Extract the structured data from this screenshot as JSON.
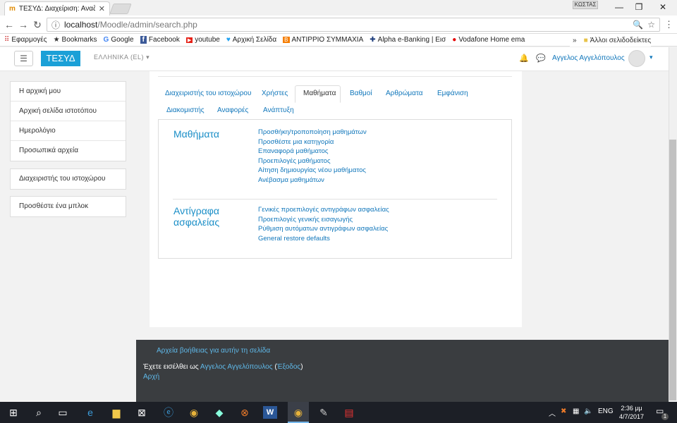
{
  "browser": {
    "tab_title": "ΤΕΣΥΔ: Διαχείριση: Αναζ",
    "user_profile": "ΚΩΣΤΑΣ",
    "url_host": "localhost",
    "url_path": "/Moodle/admin/search.php"
  },
  "bookmarks": [
    {
      "icon": "apps-icon",
      "glyph": "⠿",
      "label": "Εφαρμογές"
    },
    {
      "icon": "star-icon",
      "glyph": "★",
      "label": "Bookmarks"
    },
    {
      "icon": "google-icon",
      "glyph": "G",
      "label": "Google"
    },
    {
      "icon": "facebook-icon",
      "glyph": "f",
      "label": "Facebook"
    },
    {
      "icon": "youtube-icon",
      "glyph": "▶",
      "label": "youtube"
    },
    {
      "icon": "twitter-icon",
      "glyph": "♥",
      "label": "Αρχική Σελίδα"
    },
    {
      "icon": "blogger-icon",
      "glyph": "B",
      "label": "ΑΝΤΙΡΡΙΟ ΣΥΜΜΑΧΙΑ"
    },
    {
      "icon": "alpha-bank-icon",
      "glyph": "✚",
      "label": "Alpha e-Banking | Εισ"
    },
    {
      "icon": "vodafone-icon",
      "glyph": "●",
      "label": "Vodafone Home ema"
    }
  ],
  "bookmarks_more": "»",
  "bookmarks_other": "Άλλοι σελιδοδείκτες",
  "moodle": {
    "brand": "ΤΕΣΥΔ",
    "language": "ΕΛΛΗΝΙΚΑ (EL)",
    "user_name": "Αγγελος Αγγελόπουλος"
  },
  "sidebar": {
    "nav": [
      "Η αρχική μου",
      "Αρχική σελίδα ιστοτόπου",
      "Ημερολόγιο",
      "Προσωπικά αρχεία"
    ],
    "admin": "Διαχειριστής του ιστοχώρου",
    "add_block": "Προσθέστε ένα μπλοκ"
  },
  "tabs": {
    "row1": [
      "Διαχειριστής του ιστοχώρου",
      "Χρήστες",
      "Μαθήματα",
      "Βαθμοί",
      "Αρθρώματα",
      "Εμφάνιση"
    ],
    "row2": [
      "Διακομιστής",
      "Αναφορές",
      "Ανάπτυξη"
    ],
    "active": "Μαθήματα"
  },
  "sections": [
    {
      "heading": "Μαθήματα",
      "links": [
        "Προσθήκη/τροποποίηση μαθημάτων",
        "Προσθέστε μια κατηγορία",
        "Επαναφορά μαθήματος",
        "Προεπιλογές μαθήματος",
        "Αίτηση δημιουργίας νέου μαθήματος",
        "Ανέβασμα μαθημάτων"
      ]
    },
    {
      "heading_line1": "Αντίγραφα",
      "heading_line2": "ασφαλείας",
      "links": [
        "Γενικές προεπιλογές αντιγράφων ασφαλείας",
        "Προεπιλογές γενικής εισαγωγής",
        "Ρύθμιση αυτόματων αντιγράφων ασφαλείας",
        "General restore defaults"
      ]
    }
  ],
  "footer": {
    "help": "Αρχεία βοήθειας για αυτήν τη σελίδα",
    "logged_in_prefix": "Έχετε εισέλθει ως ",
    "user": "Αγγελος Αγγελόπουλος",
    "logout": "Έξοδος",
    "home": "Αρχή"
  },
  "taskbar": {
    "language": "ENG",
    "time": "2:36 μμ",
    "date": "4/7/2017",
    "notifications": "1"
  },
  "colors": {
    "brand": "#1ba0d7",
    "link": "#1177bb",
    "footer_bg": "#3a3d40",
    "taskbar_bg": "#1c1f26"
  }
}
